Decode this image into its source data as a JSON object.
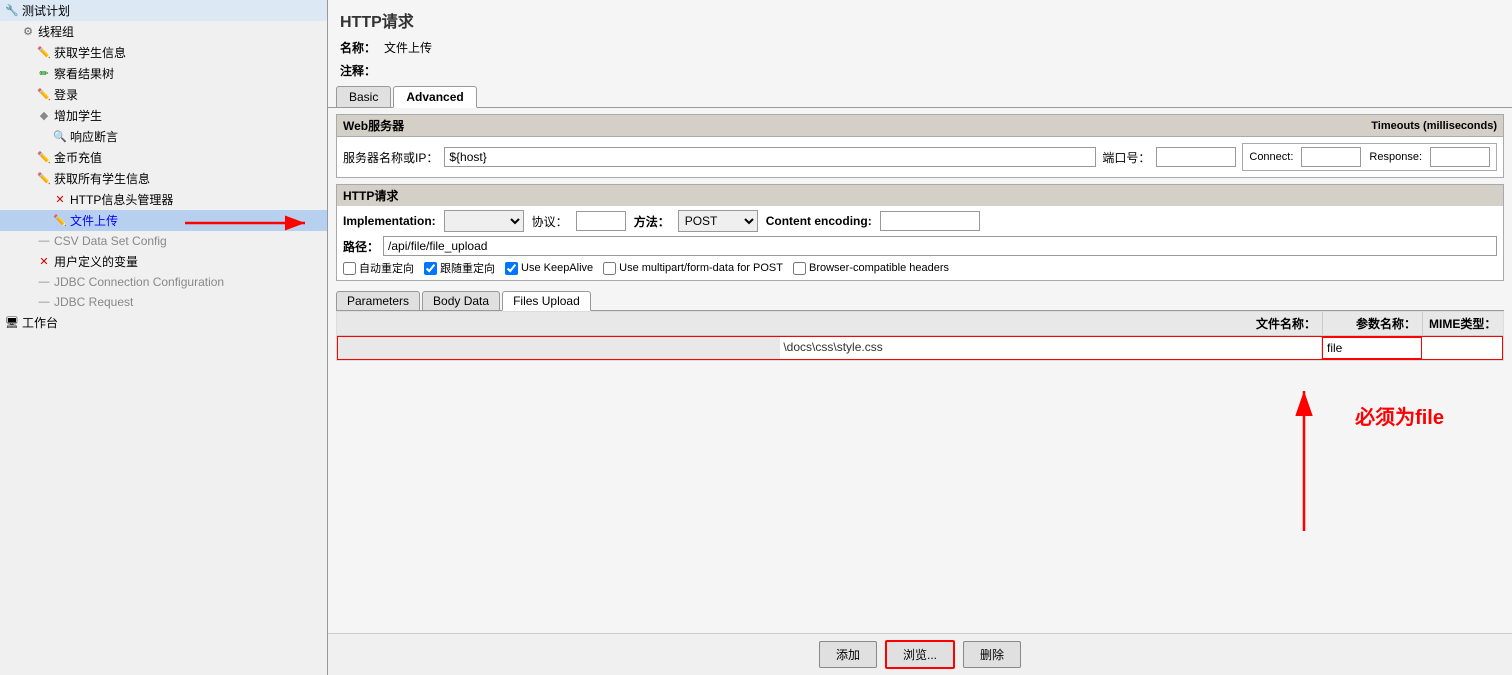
{
  "title": "HTTP请求",
  "name_label": "名称：",
  "name_value": "文件上传",
  "comment_label": "注释：",
  "tabs": {
    "basic": "Basic",
    "advanced": "Advanced"
  },
  "web_server": {
    "section_title": "Web服务器",
    "server_label": "服务器名称或IP：",
    "server_value": "${host}",
    "port_label": "端口号：",
    "port_value": "",
    "timeout_section": "Timeouts (milliseconds)",
    "connect_label": "Connect:",
    "connect_value": "",
    "response_label": "Response:",
    "response_value": ""
  },
  "http_request": {
    "section_title": "HTTP请求",
    "impl_label": "Implementation:",
    "impl_value": "",
    "protocol_label": "协议：",
    "protocol_value": "",
    "method_label": "方法：",
    "method_value": "POST",
    "encoding_label": "Content encoding:",
    "encoding_value": "",
    "path_label": "路径：",
    "path_value": "/api/file/file_upload",
    "checkboxes": [
      {
        "label": "自动重定向",
        "checked": false
      },
      {
        "label": "跟随重定向",
        "checked": true
      },
      {
        "label": "Use KeepAlive",
        "checked": true
      },
      {
        "label": "Use multipart/form-data for POST",
        "checked": false
      },
      {
        "label": "Browser-compatible headers",
        "checked": false
      }
    ]
  },
  "inner_tabs": {
    "parameters": "Parameters",
    "body_data": "Body Data",
    "files_upload": "Files Upload"
  },
  "table": {
    "col_filename": "文件名称：",
    "col_paramname": "参数名称：",
    "col_mimetype": "MIME类型：",
    "rows": [
      {
        "browse_value": "",
        "filename": "\\docs\\css\\style.css",
        "paramname": "file",
        "mimetype": ""
      }
    ]
  },
  "buttons": {
    "add": "添加",
    "browse": "浏览...",
    "delete": "删除"
  },
  "annotation": {
    "text": "必须为file"
  },
  "sidebar": {
    "items": [
      {
        "level": 0,
        "icon": "test-plan",
        "label": "测试计划",
        "type": "plan"
      },
      {
        "level": 1,
        "icon": "thread-group",
        "label": "线程组",
        "type": "thread"
      },
      {
        "level": 2,
        "icon": "sampler",
        "label": "获取学生信息",
        "type": "http"
      },
      {
        "level": 2,
        "icon": "listener",
        "label": "察看结果树",
        "type": "listener"
      },
      {
        "level": 2,
        "icon": "sampler",
        "label": "登录",
        "type": "http"
      },
      {
        "level": 2,
        "icon": "controller",
        "label": "增加学生",
        "type": "logic"
      },
      {
        "level": 3,
        "icon": "sampler",
        "label": "响应断言",
        "type": "assertion"
      },
      {
        "level": 2,
        "icon": "sampler",
        "label": "金币充值",
        "type": "http"
      },
      {
        "level": 2,
        "icon": "sampler",
        "label": "获取所有学生信息",
        "type": "http"
      },
      {
        "level": 3,
        "icon": "x-sampler",
        "label": "HTTP信息头管理器",
        "type": "config"
      },
      {
        "level": 3,
        "icon": "sampler",
        "label": "文件上传",
        "type": "http",
        "selected": true
      },
      {
        "level": 2,
        "icon": "csv",
        "label": "CSV Data Set Config",
        "type": "config"
      },
      {
        "level": 2,
        "icon": "x-sampler",
        "label": "用户定义的变量",
        "type": "config"
      },
      {
        "level": 2,
        "icon": "jdbc",
        "label": "JDBC Connection Configuration",
        "type": "config"
      },
      {
        "level": 2,
        "icon": "jdbc",
        "label": "JDBC Request",
        "type": "sampler"
      },
      {
        "level": 0,
        "icon": "workbench",
        "label": "工作台",
        "type": "workbench"
      }
    ]
  }
}
